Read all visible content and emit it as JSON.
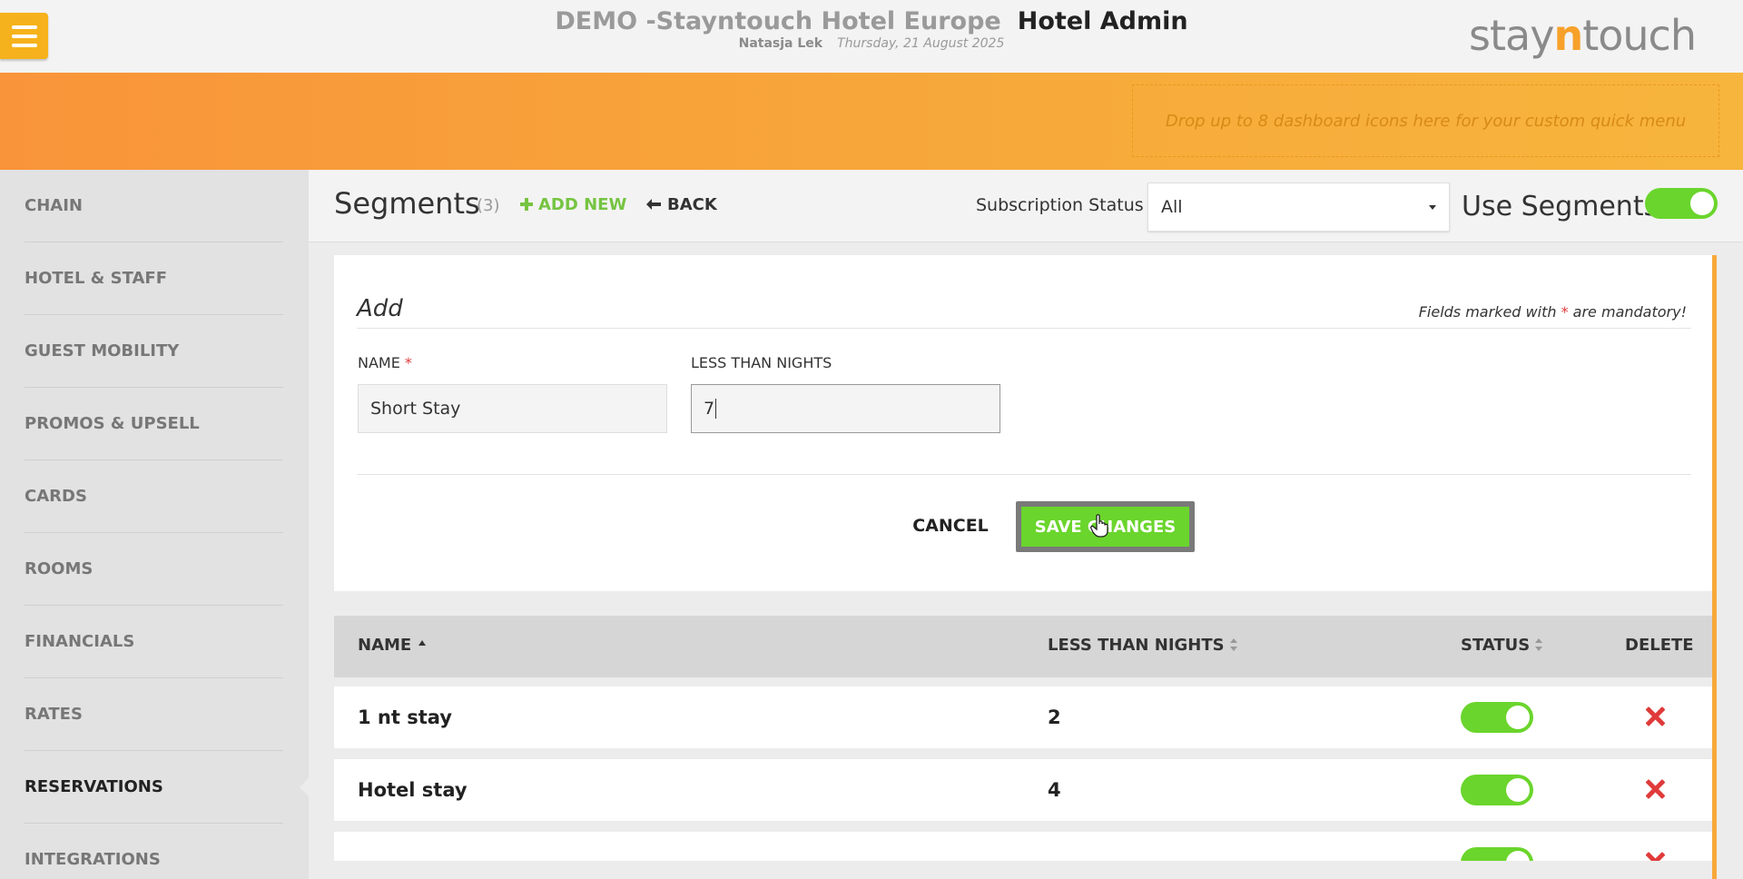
{
  "header": {
    "hotel_name": "DEMO -Stayntouch Hotel Europe",
    "admin_label": "Hotel Admin",
    "user_name": "Natasja Lek",
    "date": "Thursday, 21 August 2025",
    "logo_part1": "stay",
    "logo_part2": "n",
    "logo_part3": "touch"
  },
  "banner": {
    "dropzone_text": "Drop up to 8 dashboard icons here for your custom quick menu"
  },
  "sidebar": {
    "items": [
      {
        "label": "CHAIN"
      },
      {
        "label": "HOTEL & STAFF"
      },
      {
        "label": "GUEST MOBILITY"
      },
      {
        "label": "PROMOS & UPSELL"
      },
      {
        "label": "CARDS"
      },
      {
        "label": "ROOMS"
      },
      {
        "label": "FINANCIALS"
      },
      {
        "label": "RATES"
      },
      {
        "label": "RESERVATIONS"
      },
      {
        "label": "INTEGRATIONS"
      }
    ],
    "active": "RESERVATIONS"
  },
  "toolbar": {
    "title": "Segments",
    "count": "(3)",
    "add_new": "ADD NEW",
    "back": "BACK",
    "subscription_label": "Subscription Status",
    "subscription_value": "All",
    "use_segments_label": "Use Segments",
    "use_segments_on": true
  },
  "form": {
    "title": "Add",
    "mandatory_prefix": "Fields marked with",
    "mandatory_star": "*",
    "mandatory_suffix": "are mandatory!",
    "name_label": "NAME",
    "name_required": "*",
    "name_value": "Short Stay",
    "nights_label": "LESS THAN NIGHTS",
    "nights_value": "7",
    "cancel_label": "CANCEL",
    "save_label": "SAVE CHANGES"
  },
  "table": {
    "headers": {
      "name": "NAME",
      "nights": "LESS THAN NIGHTS",
      "status": "STATUS",
      "delete": "DELETE"
    },
    "rows": [
      {
        "name": "1 nt stay",
        "nights": "2",
        "status": true
      },
      {
        "name": "Hotel stay",
        "nights": "4",
        "status": true
      }
    ]
  },
  "colors": {
    "accent_orange": "#f7a83a",
    "success_green": "#6ad52c",
    "link_green": "#76c442",
    "danger_red": "#e03a3a"
  }
}
